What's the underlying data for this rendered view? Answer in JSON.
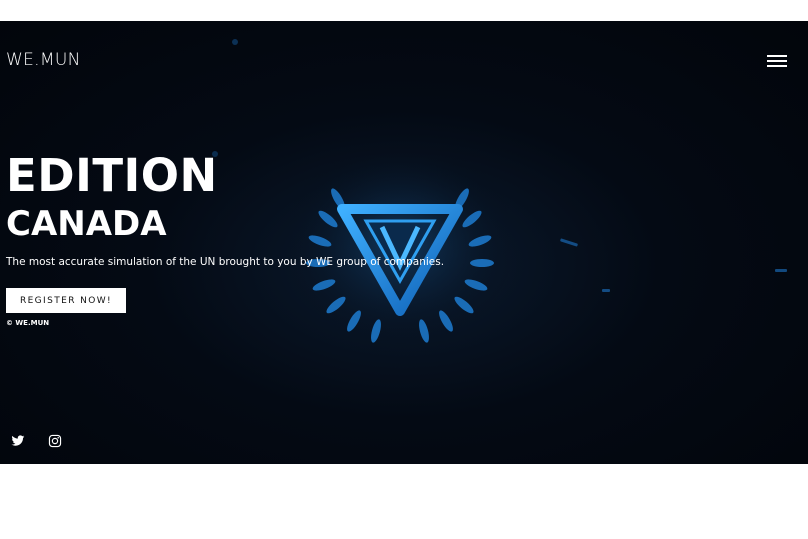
{
  "header": {
    "brand": "WE.MUN",
    "menu_icon": "hamburger-menu-icon"
  },
  "hero": {
    "title_line1": "EDITION",
    "title_line2": "CANADA",
    "tagline": "The most accurate simulation of the UN brought to you by WE group of companies.",
    "cta_label": "REGISTER NOW!",
    "copyright": "© WE.MUN",
    "emblem_icon": "laurel-triangle-emblem-icon"
  },
  "social": {
    "items": [
      {
        "icon": "twitter-icon"
      },
      {
        "icon": "instagram-icon"
      }
    ]
  },
  "colors": {
    "background": "#02050b",
    "accent": "#1f8ce8",
    "text": "#ffffff",
    "button_bg": "#ffffff"
  }
}
